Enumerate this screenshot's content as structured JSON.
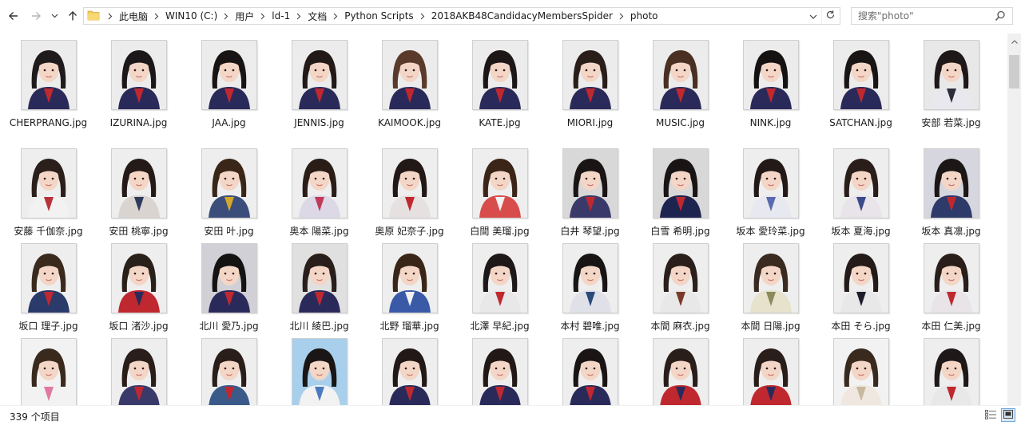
{
  "nav": {
    "back_icon": "arrow-left-icon",
    "forward_icon": "arrow-right-icon",
    "recent_icon": "chevron-down-icon",
    "up_icon": "arrow-up-icon"
  },
  "breadcrumb": [
    "此电脑",
    "WIN10 (C:)",
    "用户",
    "ld-1",
    "文档",
    "Python Scripts",
    "2018AKB48CandidacyMembersSpider",
    "photo"
  ],
  "search": {
    "placeholder": "搜索\"photo\""
  },
  "files": [
    {
      "name": "CHERPRANG.jpg",
      "bg": "#ececec",
      "hair": "#1f1a1b",
      "outfit": "#2a2a5a",
      "accent": "#c0282f"
    },
    {
      "name": "IZURINA.jpg",
      "bg": "#ececec",
      "hair": "#1c1718",
      "outfit": "#2a2a5a",
      "accent": "#c0282f"
    },
    {
      "name": "JAA.jpg",
      "bg": "#ececec",
      "hair": "#181414",
      "outfit": "#2a2a5a",
      "accent": "#c0282f"
    },
    {
      "name": "JENNIS.jpg",
      "bg": "#ececec",
      "hair": "#221a18",
      "outfit": "#2a2a5a",
      "accent": "#c0282f"
    },
    {
      "name": "KAIMOOK.jpg",
      "bg": "#ececec",
      "hair": "#5a3a2a",
      "outfit": "#2a2a5a",
      "accent": "#c0282f"
    },
    {
      "name": "KATE.jpg",
      "bg": "#ececec",
      "hair": "#1d1617",
      "outfit": "#2a2a5a",
      "accent": "#c0282f"
    },
    {
      "name": "MIORI.jpg",
      "bg": "#ececec",
      "hair": "#2a1e1a",
      "outfit": "#2a2a5a",
      "accent": "#c0282f"
    },
    {
      "name": "MUSIC.jpg",
      "bg": "#ececec",
      "hair": "#4a3022",
      "outfit": "#2a2a5a",
      "accent": "#c0282f"
    },
    {
      "name": "NINK.jpg",
      "bg": "#ececec",
      "hair": "#151212",
      "outfit": "#2a2a5a",
      "accent": "#c0282f"
    },
    {
      "name": "SATCHAN.jpg",
      "bg": "#ececec",
      "hair": "#1a1515",
      "outfit": "#2a2a5a",
      "accent": "#c0282f"
    },
    {
      "name": "安部 若菜.jpg",
      "bg": "#e8e8e8",
      "hair": "#1e1818",
      "outfit": "#e8e8ee",
      "accent": "#2d2d3a"
    },
    {
      "name": "安藤 千伽奈.jpg",
      "bg": "#eeeeee",
      "hair": "#2a1f1b",
      "outfit": "#f2f2f2",
      "accent": "#b8323a"
    },
    {
      "name": "安田 桃寧.jpg",
      "bg": "#eeeeee",
      "hair": "#241b18",
      "outfit": "#d9d4d0",
      "accent": "#2d3a5a"
    },
    {
      "name": "安田 叶.jpg",
      "bg": "#eeeeee",
      "hair": "#3a2618",
      "outfit": "#3b4d7a",
      "accent": "#d4a72c"
    },
    {
      "name": "奥本 陽菜.jpg",
      "bg": "#eeeeee",
      "hair": "#2a1d18",
      "outfit": "#dcd8e6",
      "accent": "#c03a5a"
    },
    {
      "name": "奥原 妃奈子.jpg",
      "bg": "#eeeeee",
      "hair": "#221917",
      "outfit": "#e6e0e0",
      "accent": "#c0282f"
    },
    {
      "name": "白間 美瑠.jpg",
      "bg": "#eeeeee",
      "hair": "#3a2518",
      "outfit": "#d94c4c",
      "accent": "#f2f2f2"
    },
    {
      "name": "白井 琴望.jpg",
      "bg": "#d8d8d8",
      "hair": "#1a1414",
      "outfit": "#3a3a6a",
      "accent": "#c0282f"
    },
    {
      "name": "白雪 希明.jpg",
      "bg": "#d8d8d8",
      "hair": "#1a1414",
      "outfit": "#1e2450",
      "accent": "#c0282f"
    },
    {
      "name": "坂本 愛玲菜.jpg",
      "bg": "#eeeeee",
      "hair": "#231a18",
      "outfit": "#e8e8f0",
      "accent": "#5a6ab0"
    },
    {
      "name": "坂本 夏海.jpg",
      "bg": "#eeeeee",
      "hair": "#2a1e1a",
      "outfit": "#e8e4ea",
      "accent": "#3a4a8a"
    },
    {
      "name": "坂本 真凛.jpg",
      "bg": "#d6d6de",
      "hair": "#1c1616",
      "outfit": "#2d3a6a",
      "accent": "#c0282f"
    },
    {
      "name": "坂口 理子.jpg",
      "bg": "#eeeeee",
      "hair": "#3a2a1e",
      "outfit": "#2a3a6a",
      "accent": "#c0282f"
    },
    {
      "name": "坂口 渚沙.jpg",
      "bg": "#eeeeee",
      "hair": "#2a201a",
      "outfit": "#c0282f",
      "accent": "#2a2a5a"
    },
    {
      "name": "北川 愛乃.jpg",
      "bg": "#d0d0d6",
      "hair": "#151212",
      "outfit": "#2a2a5a",
      "accent": "#c0282f"
    },
    {
      "name": "北川 綾巴.jpg",
      "bg": "#e0e0e0",
      "hair": "#2a1e1a",
      "outfit": "#2a2a5a",
      "accent": "#c0282f"
    },
    {
      "name": "北野 瑠華.jpg",
      "bg": "#eeeeee",
      "hair": "#3a2618",
      "outfit": "#3a5aa8",
      "accent": "#f2f2f2"
    },
    {
      "name": "北澤 早紀.jpg",
      "bg": "#eeeeee",
      "hair": "#1e1818",
      "outfit": "#e8e8e8",
      "accent": "#c0282f"
    },
    {
      "name": "本村 碧唯.jpg",
      "bg": "#eeeeee",
      "hair": "#1a1515",
      "outfit": "#e0e0e8",
      "accent": "#2a4a7a"
    },
    {
      "name": "本間 麻衣.jpg",
      "bg": "#eeeeee",
      "hair": "#2a1f1b",
      "outfit": "#e8e8e8",
      "accent": "#7a3a2a"
    },
    {
      "name": "本間 日陽.jpg",
      "bg": "#eeeeee",
      "hair": "#3a2a20",
      "outfit": "#e6e2cc",
      "accent": "#8a8a5a"
    },
    {
      "name": "本田 そら.jpg",
      "bg": "#eeeeee",
      "hair": "#241b18",
      "outfit": "#e8e8e8",
      "accent": "#1e1e2a"
    },
    {
      "name": "本田 仁美.jpg",
      "bg": "#eeeeee",
      "hair": "#2a1e1a",
      "outfit": "#e8e4e8",
      "accent": "#c0282f"
    },
    {
      "name": "",
      "bg": "#f2f2f2",
      "hair": "#3a2a1e",
      "outfit": "#f2f2f2",
      "accent": "#e07aa0"
    },
    {
      "name": "",
      "bg": "#eeeeee",
      "hair": "#2a1e1a",
      "outfit": "#3a3a6a",
      "accent": "#c0282f"
    },
    {
      "name": "",
      "bg": "#eeeeee",
      "hair": "#2a1e1a",
      "outfit": "#3a5a8a",
      "accent": "#c0282f"
    },
    {
      "name": "",
      "bg": "#a8d0ec",
      "hair": "#1a1616",
      "outfit": "#f2f2f2",
      "accent": "#4a7ac0"
    },
    {
      "name": "",
      "bg": "#eeeeee",
      "hair": "#221917",
      "outfit": "#2a2a5a",
      "accent": "#c0282f"
    },
    {
      "name": "",
      "bg": "#eeeeee",
      "hair": "#221917",
      "outfit": "#2a2a5a",
      "accent": "#c0282f"
    },
    {
      "name": "",
      "bg": "#eeeeee",
      "hair": "#1a1414",
      "outfit": "#2a2a5a",
      "accent": "#c0282f"
    },
    {
      "name": "",
      "bg": "#eeeeee",
      "hair": "#2a1e1a",
      "outfit": "#c0282f",
      "accent": "#2a2a5a"
    },
    {
      "name": "",
      "bg": "#eeeeee",
      "hair": "#2a1e1a",
      "outfit": "#c0282f",
      "accent": "#2a2a5a"
    },
    {
      "name": "",
      "bg": "#f2f2f2",
      "hair": "#3a2a1e",
      "outfit": "#f0e8e0",
      "accent": "#c8b8a0"
    },
    {
      "name": "",
      "bg": "#eeeeee",
      "hair": "#1e1818",
      "outfit": "#e8e8e8",
      "accent": "#c0282f"
    }
  ],
  "status": {
    "item_count": "339 个项目"
  },
  "scroll_fraction": 0.02
}
